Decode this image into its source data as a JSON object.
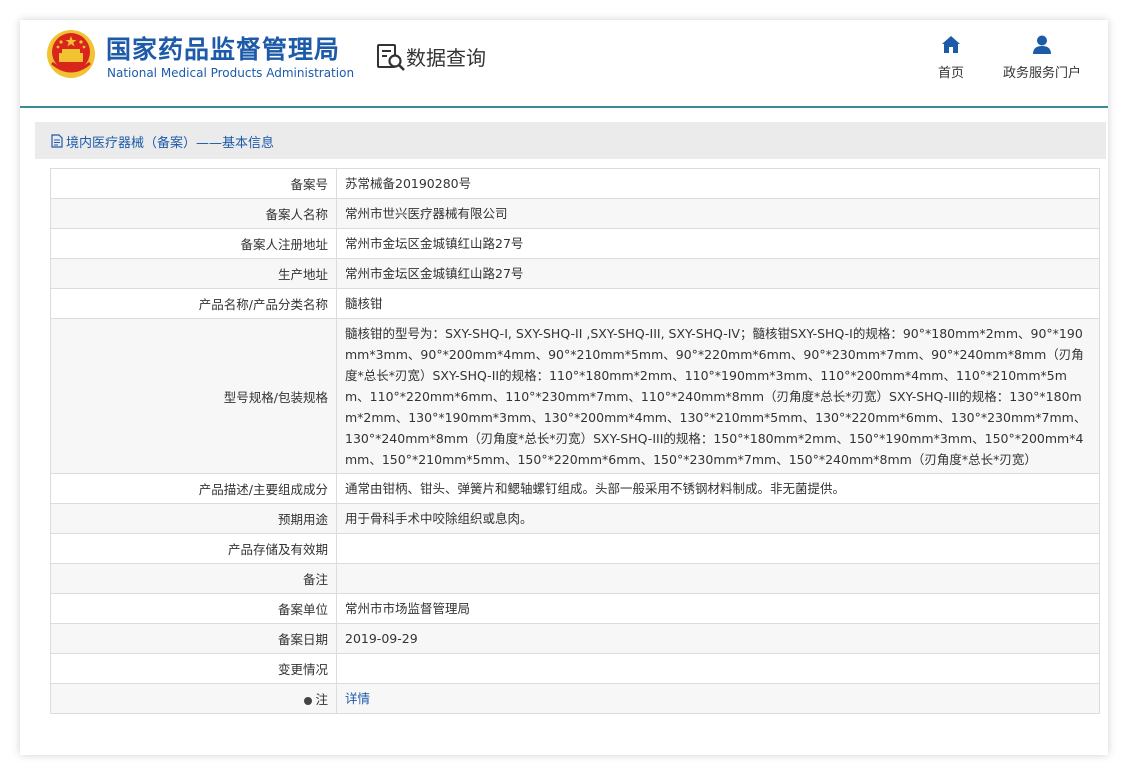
{
  "header": {
    "logo_cn": "国家药品监督管理局",
    "logo_en": "National Medical Products Administration",
    "search_title": "数据查询",
    "nav": [
      {
        "label": "首页",
        "icon": "home-icon"
      },
      {
        "label": "政务服务门户",
        "icon": "user-icon"
      }
    ]
  },
  "section": {
    "title": "境内医疗器械（备案）——基本信息"
  },
  "rows": [
    {
      "label": "备案号",
      "value": "苏常械备20190280号"
    },
    {
      "label": "备案人名称",
      "value": "常州市世兴医疗器械有限公司"
    },
    {
      "label": "备案人注册地址",
      "value": "常州市金坛区金城镇红山路27号"
    },
    {
      "label": "生产地址",
      "value": "常州市金坛区金城镇红山路27号"
    },
    {
      "label": "产品名称/产品分类名称",
      "value": "髓核钳"
    },
    {
      "label": "型号规格/包装规格",
      "value": "髓核钳的型号为：SXY-SHQ-I, SXY-SHQ-II ,SXY-SHQ-III, SXY-SHQ-IV；髓核钳SXY-SHQ-I的规格：90°*180mm*2mm、90°*190mm*3mm、90°*200mm*4mm、90°*210mm*5mm、90°*220mm*6mm、90°*230mm*7mm、90°*240mm*8mm（刃角度*总长*刃宽）SXY-SHQ-II的规格：110°*180mm*2mm、110°*190mm*3mm、110°*200mm*4mm、110°*210mm*5mm、110°*220mm*6mm、110°*230mm*7mm、110°*240mm*8mm（刃角度*总长*刃宽）SXY-SHQ-III的规格：130°*180mm*2mm、130°*190mm*3mm、130°*200mm*4mm、130°*210mm*5mm、130°*220mm*6mm、130°*230mm*7mm、130°*240mm*8mm（刃角度*总长*刃宽）SXY-SHQ-III的规格：150°*180mm*2mm、150°*190mm*3mm、150°*200mm*4mm、150°*210mm*5mm、150°*220mm*6mm、150°*230mm*7mm、150°*240mm*8mm（刃角度*总长*刃宽）"
    },
    {
      "label": "产品描述/主要组成成分",
      "value": "通常由钳柄、钳头、弹簧片和鳃轴螺钉组成。头部一般采用不锈钢材料制成。非无菌提供。"
    },
    {
      "label": "预期用途",
      "value": "用于骨科手术中咬除组织或息肉。"
    },
    {
      "label": "产品存储及有效期",
      "value": ""
    },
    {
      "label": "备注",
      "value": ""
    },
    {
      "label": "备案单位",
      "value": "常州市市场监督管理局"
    },
    {
      "label": "备案日期",
      "value": "2019-09-29"
    },
    {
      "label": "变更情况",
      "value": ""
    },
    {
      "label": "注",
      "value": "详情"
    }
  ],
  "colors": {
    "brand_blue": "#1d5ba9",
    "header_rule": "#3c8a95",
    "emblem_red": "#d8261c",
    "emblem_gold": "#f2c232"
  }
}
